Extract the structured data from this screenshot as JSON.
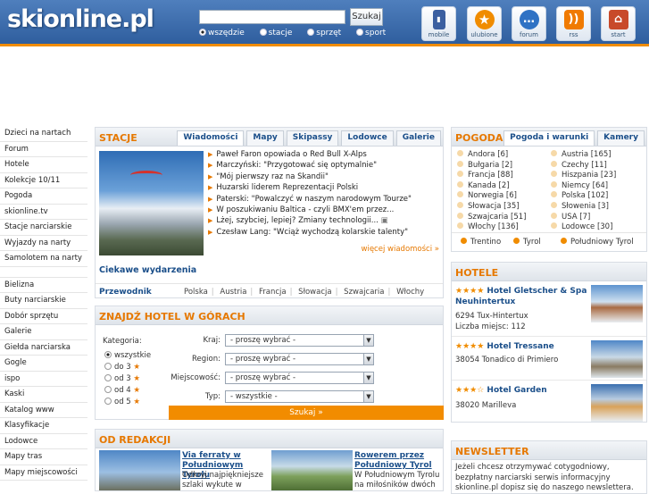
{
  "header": {
    "logo": "skionline.pl",
    "search": {
      "placeholder": "",
      "button": "Szukaj"
    },
    "scopes": [
      {
        "label": "wszędzie",
        "selected": true
      },
      {
        "label": "stacje",
        "selected": false
      },
      {
        "label": "sprzęt",
        "selected": false
      },
      {
        "label": "sport",
        "selected": false
      }
    ],
    "icons": [
      {
        "label": "mobile",
        "icon": "mobile-icon",
        "color": "#3b5fa0"
      },
      {
        "label": "ulubione",
        "icon": "star-icon",
        "color": "#f08c00"
      },
      {
        "label": "forum",
        "icon": "chat-icon",
        "color": "#2f72c4"
      },
      {
        "label": "rss",
        "icon": "rss-icon",
        "color": "#f07a00"
      },
      {
        "label": "start",
        "icon": "home-icon",
        "color": "#c84a2a"
      }
    ]
  },
  "nav": {
    "group1": [
      "Dzieci na nartach",
      "Forum",
      "Hotele",
      "Kolekcje 10/11",
      "Pogoda",
      "skionline.tv",
      "Stacje narciarskie",
      "Wyjazdy na narty",
      "Samolotem na narty"
    ],
    "group2": [
      "Bielizna",
      "Buty narciarskie",
      "Dobór sprzętu",
      "Galerie",
      "Giełda narciarska",
      "Gogle",
      "ispo",
      "Kaski",
      "Katalog www",
      "Klasyfikacje",
      "Lodowce",
      "Mapy tras",
      "Mapy miejscowości"
    ]
  },
  "stacje": {
    "title": "STACJE",
    "tabs": [
      "Wiadomości",
      "Mapy",
      "Skipassy",
      "Lodowce",
      "Galerie"
    ],
    "news": [
      "Paweł Faron opowiada o Red Bull X-Alps",
      "Marczyński: \"Przygotować się optymalnie\"",
      "\"Mój pierwszy raz na Skandii\"",
      "Huzarski liderem Reprezentacji Polski",
      "Paterski: \"Powalczyć w naszym narodowym Tourze\"",
      "W poszukiwaniu Baltica - czyli BMX'em przez...",
      "Lżej, szybciej, lepiej? Zmiany technologii...",
      "Czesław Lang: \"Wciąż wychodzą kolarskie talenty\""
    ],
    "more": "więcej wiadomości »",
    "ciekawe": "Ciekawe wydarzenia",
    "przewodnik": {
      "label": "Przewodnik",
      "countries": [
        "Polska",
        "Austria",
        "Francja",
        "Słowacja",
        "Szwajcaria",
        "Włochy"
      ]
    }
  },
  "hotel_search": {
    "title": "ZNAJDŹ HOTEL W GÓRACH",
    "category_label": "Kategoria:",
    "categories": [
      "wszystkie",
      "do 3",
      "od 3",
      "od 4",
      "od 5"
    ],
    "star": "★",
    "fields": [
      {
        "label": "Kraj:",
        "value": "- proszę wybrać -"
      },
      {
        "label": "Region:",
        "value": "- proszę wybrać -"
      },
      {
        "label": "Miejscowość:",
        "value": "- proszę wybrać -"
      },
      {
        "label": "Typ:",
        "value": "- wszystkie -"
      }
    ],
    "button": "Szukaj »"
  },
  "redakcja": {
    "title": "OD REDAKCJI",
    "items": [
      {
        "title": "Via ferraty w Południowym Tyrolu",
        "text": "Odkryj najpiękniejsze szlaki wykute w"
      },
      {
        "title": "Rowerem przez Południowy Tyrol",
        "text": "W Południowym Tyrolu na miłośników dwóch"
      }
    ]
  },
  "pogoda": {
    "title": "POGODA",
    "tabs": [
      "Pogoda i warunki",
      "Kamery"
    ],
    "col1": [
      "Andora [6]",
      "Bułgaria [2]",
      "Francja [88]",
      "Kanada [2]",
      "Norwegia [6]",
      "Słowacja [35]",
      "Szwajcaria [51]",
      "Włochy [136]"
    ],
    "col2": [
      "Austria [165]",
      "Czechy [11]",
      "Hiszpania [23]",
      "Niemcy [64]",
      "Polska [102]",
      "Słowenia [3]",
      "USA [7]",
      "Lodowce [30]"
    ],
    "regions": [
      "Trentino",
      "Tyrol",
      "Południowy Tyrol"
    ]
  },
  "hotele": {
    "title": "HOTELE",
    "items": [
      {
        "stars": "★★★★",
        "name": "Hotel Gletscher & Spa Neuhintertux",
        "address": [
          "6294 Tux-Hintertux",
          "Liczba miejsc: 112"
        ]
      },
      {
        "stars": "★★★★",
        "name": "Hotel Tressane",
        "address": [
          "38054 Tonadico di Primiero"
        ]
      },
      {
        "stars": "★★★☆",
        "name": "Hotel Garden",
        "address": [
          "38020 Marilleva"
        ]
      }
    ]
  },
  "newsletter": {
    "title": "NEWSLETTER",
    "text": "Jeżeli chcesz otrzymywać cotygodniowy, bezpłatny narciarski serwis informacyjny skionline.pl dopisz się do naszego newslettera."
  }
}
